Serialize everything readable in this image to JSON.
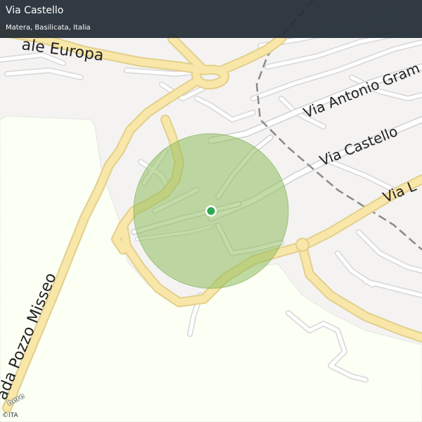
{
  "header": {
    "title": "Via Castello",
    "subtitle": "Matera, Basilicata, Italia"
  },
  "streets": {
    "viale_europa": "ale Europa",
    "via_antonio_gramsci": "Via Antonio Gram",
    "via_castello": "Via Castello",
    "via_l": "Via L",
    "strada_pozzo_misseo": "ada Pozzo Misseo"
  },
  "branding": {
    "logo_text": "here",
    "copyright": "©ITA"
  },
  "colors": {
    "header_bg": "#1f2a33",
    "land": "#f4f3f2",
    "green_area": "#fbfff4",
    "major_road": "#f8e7a8",
    "minor_road": "#ffffff",
    "accuracy_circle": "#8fbd5f",
    "location_dot": "#2fa84f"
  },
  "marker": {
    "type": "current-location",
    "icon": "location-dot-icon"
  }
}
